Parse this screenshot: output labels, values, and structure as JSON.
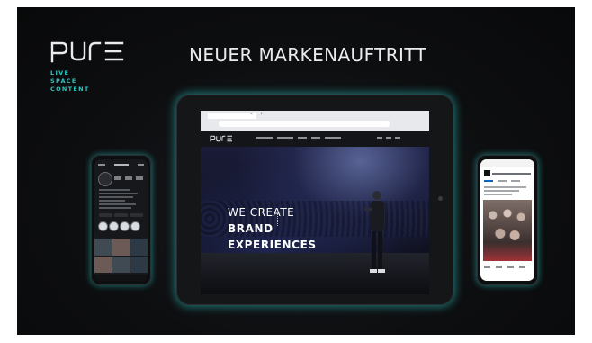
{
  "brand": {
    "logo_text": "PURE",
    "tagline": [
      "LIVE",
      "SPACE",
      "CONTENT"
    ],
    "accent_color": "#2ec6c0"
  },
  "headline": "NEUER MARKENAUFTRITT",
  "tablet": {
    "website": {
      "logo_text": "PURE",
      "hero_lines": [
        "WE CREATE",
        "BRAND",
        "EXPERIENCES"
      ]
    }
  },
  "phones": {
    "left": {
      "app": "instagram-profile"
    },
    "right": {
      "app": "linkedin-post"
    }
  },
  "colors": {
    "background": "#0d0e10",
    "text": "#e9ecee",
    "glow": "#2ec6c0"
  }
}
